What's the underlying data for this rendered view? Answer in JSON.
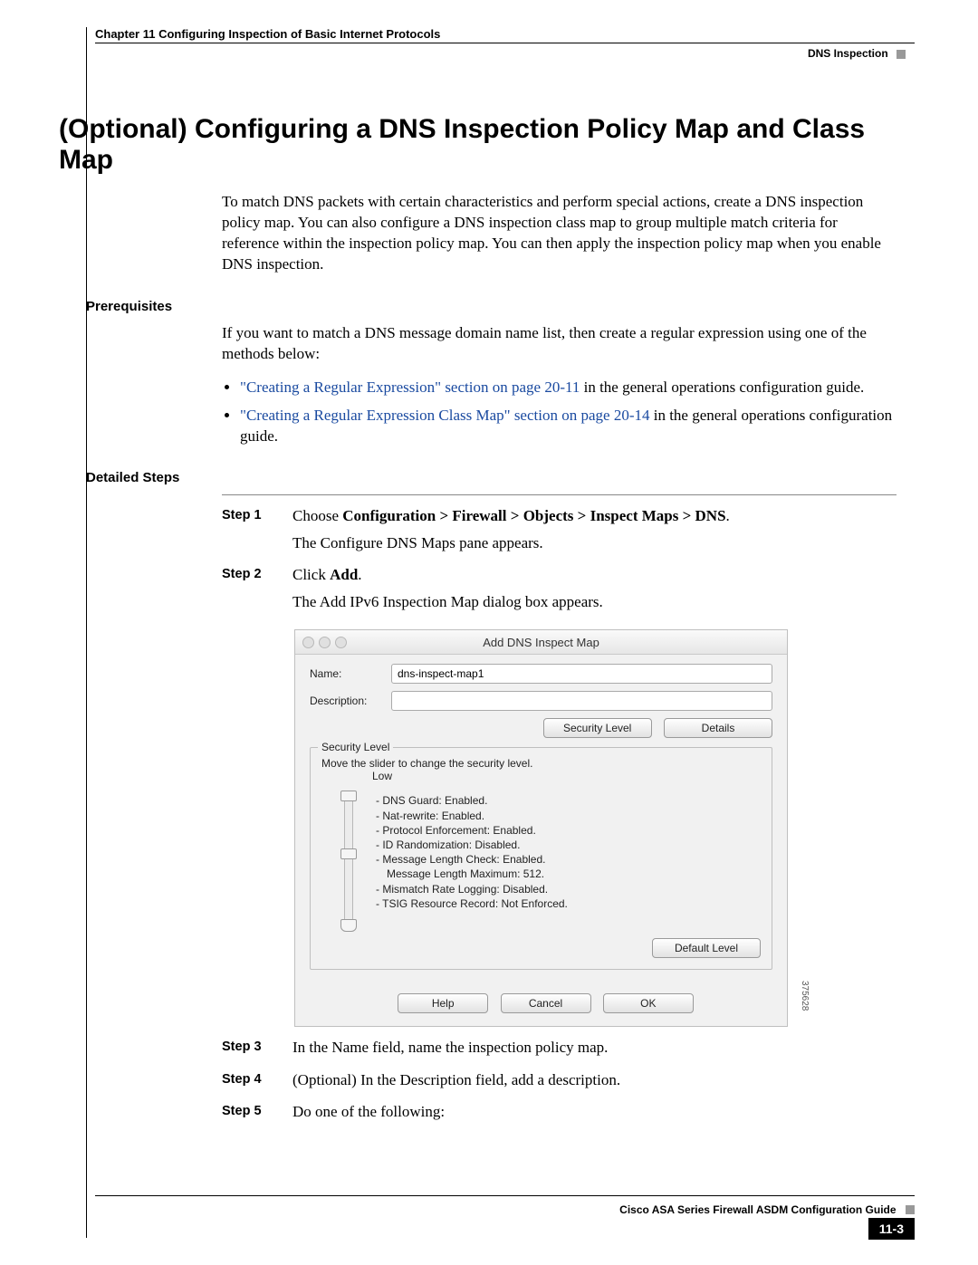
{
  "header": {
    "chapter_line": "Chapter 11    Configuring Inspection of Basic Internet Protocols",
    "section_label": "DNS Inspection"
  },
  "title": "(Optional) Configuring a DNS Inspection Policy Map and Class Map",
  "intro": "To match DNS packets with certain characteristics and perform special actions, create a DNS inspection policy map. You can also configure a DNS inspection class map to group multiple match criteria for reference within the inspection policy map. You can then apply the inspection policy map when you enable DNS inspection.",
  "prereq": {
    "heading": "Prerequisites",
    "text": "If you want to match a DNS message domain name list, then create a regular expression using one of the methods below:",
    "bullets": [
      {
        "link": "\"Creating a Regular Expression\" section on page 20-11",
        "tail": " in the general operations configuration guide."
      },
      {
        "link": "\"Creating a Regular Expression Class Map\" section on page 20-14",
        "tail": " in the general operations configuration guide."
      }
    ]
  },
  "detailed_heading": "Detailed Steps",
  "steps": [
    {
      "label": "Step 1",
      "line1_pre": "Choose ",
      "line1_bold": "Configuration > Firewall > Objects > Inspect Maps > DNS",
      "line1_post": ".",
      "line2": "The Configure DNS Maps pane appears."
    },
    {
      "label": "Step 2",
      "line1_pre": "Click ",
      "line1_bold": "Add",
      "line1_post": ".",
      "line2": "The Add IPv6 Inspection Map dialog box appears."
    },
    {
      "label": "Step 3",
      "line1_pre": "In the Name field, name the inspection policy map.",
      "line1_bold": "",
      "line1_post": "",
      "line2": ""
    },
    {
      "label": "Step 4",
      "line1_pre": "(Optional) In the Description field, add a description.",
      "line1_bold": "",
      "line1_post": "",
      "line2": ""
    },
    {
      "label": "Step 5",
      "line1_pre": "Do one of the following:",
      "line1_bold": "",
      "line1_post": "",
      "line2": ""
    }
  ],
  "dialog": {
    "title": "Add DNS Inspect Map",
    "name_label": "Name:",
    "name_value": "dns-inspect-map1",
    "desc_label": "Description:",
    "desc_value": "",
    "btn_security": "Security Level",
    "btn_details": "Details",
    "fieldset_legend": "Security Level",
    "slider_instruction": "Move the slider to change the security level.",
    "low_label": "Low",
    "items": [
      "DNS Guard: Enabled.",
      "Nat-rewrite: Enabled.",
      "Protocol Enforcement: Enabled.",
      "ID Randomization: Disabled.",
      "Message Length Check: Enabled.",
      "Message Length Maximum: 512.",
      "Mismatch Rate Logging: Disabled.",
      "TSIG Resource Record: Not Enforced."
    ],
    "btn_default": "Default Level",
    "btn_help": "Help",
    "btn_cancel": "Cancel",
    "btn_ok": "OK",
    "side_code": "375628"
  },
  "footer": {
    "guide": "Cisco ASA Series Firewall ASDM Configuration Guide",
    "page": "11-3"
  }
}
